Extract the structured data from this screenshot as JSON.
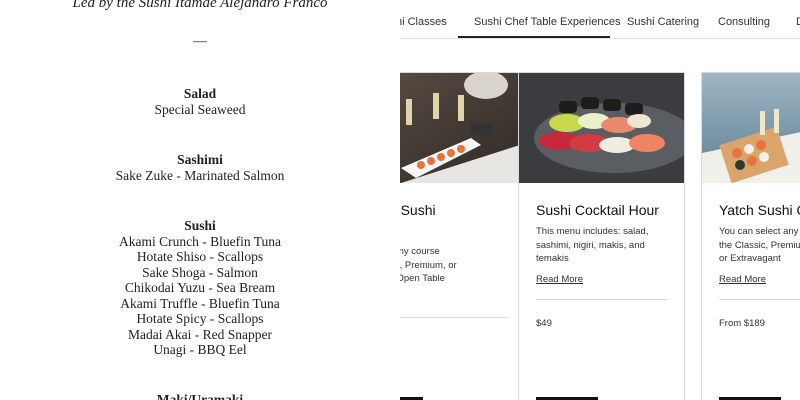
{
  "menu": {
    "led_by": "Led by the Sushi Itamae Alejandro Franco",
    "dash": "—",
    "salad": {
      "heading": "Salad",
      "items": [
        "Special Seaweed"
      ]
    },
    "sashimi": {
      "heading": "Sashimi",
      "items": [
        "Sake Zuke - Marinated Salmon"
      ]
    },
    "sushi": {
      "heading": "Sushi",
      "items": [
        "Akami Crunch - Bluefin Tuna",
        "Hotate Shiso - Scallops",
        "Sake Shoga - Salmon",
        "Chikodai Yuzu - Sea Bream",
        "Akami Truffle - Bluefin Tuna",
        "Hotate Spicy - Scallops",
        "Madai Akai - Red Snapper",
        "Unagi - BBQ Eel"
      ]
    },
    "maki": {
      "heading": "Maki/Uramaki"
    }
  },
  "tabs": [
    {
      "label": "hi Classes"
    },
    {
      "label": "Sushi Chef Table Experiences",
      "active": true
    },
    {
      "label": "Sushi Catering"
    },
    {
      "label": "Consulting"
    },
    {
      "label": "D"
    }
  ],
  "cards": [
    {
      "title_line1": "Jet Sushi",
      "title_line2": "e",
      "description": "ect any course\nassic, Premium, or\nenu Open Table",
      "read_more": "",
      "price": "",
      "image": "sushi-on-jet-image"
    },
    {
      "title_line1": "Sushi Cocktail Hour",
      "description": "This menu includes: salad, sashimi, nigiri, makis, and temakis",
      "read_more": "Read More",
      "price": "$49",
      "image": "sushi-platter-image"
    },
    {
      "title_line1": "Yatch Sushi O",
      "description": "You can select any\nthe Classic, Premiu\nor Extravagant",
      "read_more": "Read More",
      "price": "From $189",
      "image": "sushi-on-yacht-image"
    }
  ]
}
